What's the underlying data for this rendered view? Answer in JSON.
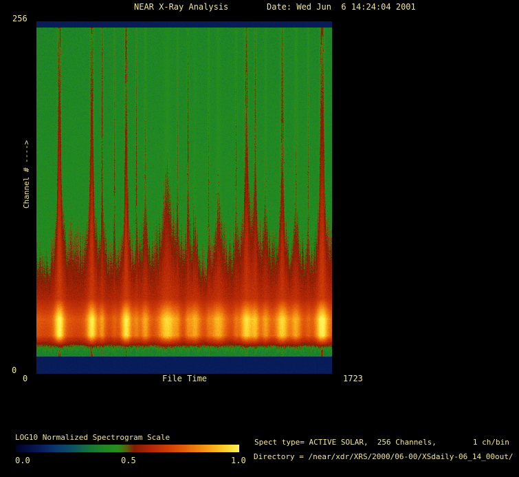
{
  "header": {
    "title": "NEAR X-Ray Analysis",
    "date": "Date: Wed Jun  6 14:24:04 2001"
  },
  "axes": {
    "y": {
      "label": "Channel # ---->",
      "max": "256",
      "min": "0"
    },
    "x": {
      "label": "File Time",
      "min": "0",
      "max": "1723"
    }
  },
  "colorbar": {
    "title": "LOG10 Normalized Spectrogram Scale",
    "ticks": [
      "0.0",
      "0.5",
      "1.0"
    ]
  },
  "info": {
    "line1": "Spect type= ACTIVE SOLAR,  256 Channels,        1 ch/bin",
    "line2": "Directory = /near/xdr/XRS/2000/06-00/XSdaily-06_14_00out/"
  },
  "colors": {
    "text": "#f0e68c",
    "background": "#000000",
    "border_band": "#0f2e62"
  },
  "chart_data": {
    "type": "heatmap",
    "title": "NEAR X-Ray Analysis",
    "date": "Wed Jun  6 14:24:04 2001",
    "xlabel": "File Time",
    "ylabel": "Channel #",
    "xlim": [
      0,
      1723
    ],
    "ylim": [
      0,
      256
    ],
    "scale_label": "LOG10 Normalized Spectrogram Scale",
    "scale_ticks": [
      0.0,
      0.5,
      1.0
    ],
    "spect_type": "ACTIVE SOLAR",
    "channels": 256,
    "ch_per_bin": 1,
    "directory": "/near/xdr/XRS/2000/06-00/XSdaily-06_14_00out/",
    "description": "Normalized X-ray spectrogram: green quiet background at high channels, bright orange-yellow continuum band at low channels, vertical red/yellow flare streaks",
    "background_level": 0.4,
    "band_peak_level": 0.78,
    "flares": [
      {
        "t": 132,
        "a": 1.0,
        "w": 5,
        "s": 0.95
      },
      {
        "t": 321,
        "a": 0.9,
        "w": 5,
        "s": 0.9
      },
      {
        "t": 381,
        "a": 0.4,
        "w": 3,
        "s": 0.55
      },
      {
        "t": 453,
        "a": 0.2,
        "w": 3,
        "s": 0.35
      },
      {
        "t": 521,
        "a": 0.9,
        "w": 5,
        "s": 0.65
      },
      {
        "t": 581,
        "a": 0.25,
        "w": 3,
        "s": 0.4
      },
      {
        "t": 633,
        "a": 0.45,
        "w": 4,
        "s": 0.3
      },
      {
        "t": 761,
        "a": 0.75,
        "w": 9,
        "s": 0.15
      },
      {
        "t": 821,
        "a": 0.2,
        "w": 3,
        "s": 0.3
      },
      {
        "t": 882,
        "a": 0.3,
        "w": 3,
        "s": 0.45
      },
      {
        "t": 922,
        "a": 0.5,
        "w": 5,
        "s": 0.1
      },
      {
        "t": 1002,
        "a": 0.2,
        "w": 3,
        "s": 0.3
      },
      {
        "t": 1058,
        "a": 0.55,
        "w": 7,
        "s": 0.15
      },
      {
        "t": 1162,
        "a": 0.25,
        "w": 3,
        "s": 0.35
      },
      {
        "t": 1222,
        "a": 0.8,
        "w": 6,
        "s": 0.55
      },
      {
        "t": 1274,
        "a": 0.55,
        "w": 4,
        "s": 0.45
      },
      {
        "t": 1334,
        "a": 0.4,
        "w": 4,
        "s": 0.2
      },
      {
        "t": 1431,
        "a": 0.75,
        "w": 6,
        "s": 0.5
      },
      {
        "t": 1511,
        "a": 0.5,
        "w": 5,
        "s": 0.25
      },
      {
        "t": 1583,
        "a": 0.2,
        "w": 3,
        "s": 0.3
      },
      {
        "t": 1663,
        "a": 1.0,
        "w": 6,
        "s": 0.9
      }
    ],
    "dips": [
      {
        "t": 52,
        "a": -0.12,
        "w": 9
      },
      {
        "t": 236,
        "a": -0.16,
        "w": 9
      },
      {
        "t": 449,
        "a": -0.18,
        "w": 8
      },
      {
        "t": 693,
        "a": -0.12,
        "w": 6
      },
      {
        "t": 854,
        "a": -0.1,
        "w": 6
      },
      {
        "t": 990,
        "a": -0.1,
        "w": 5
      },
      {
        "t": 1146,
        "a": -0.14,
        "w": 9
      },
      {
        "t": 1579,
        "a": -0.14,
        "w": 8
      }
    ],
    "colormap": [
      [
        0.0,
        [
          2,
          2,
          40
        ]
      ],
      [
        0.1,
        [
          8,
          26,
          88
        ]
      ],
      [
        0.18,
        [
          12,
          56,
          112
        ]
      ],
      [
        0.26,
        [
          14,
          84,
          96
        ]
      ],
      [
        0.33,
        [
          22,
          116,
          58
        ]
      ],
      [
        0.4,
        [
          32,
          136,
          34
        ]
      ],
      [
        0.46,
        [
          40,
          142,
          28
        ]
      ],
      [
        0.5,
        [
          96,
          88,
          12
        ]
      ],
      [
        0.53,
        [
          128,
          28,
          4
        ]
      ],
      [
        0.6,
        [
          178,
          38,
          6
        ]
      ],
      [
        0.68,
        [
          206,
          60,
          8
        ]
      ],
      [
        0.76,
        [
          230,
          98,
          12
        ]
      ],
      [
        0.85,
        [
          246,
          152,
          22
        ]
      ],
      [
        0.93,
        [
          252,
          204,
          40
        ]
      ],
      [
        1.0,
        [
          255,
          242,
          84
        ]
      ]
    ]
  }
}
